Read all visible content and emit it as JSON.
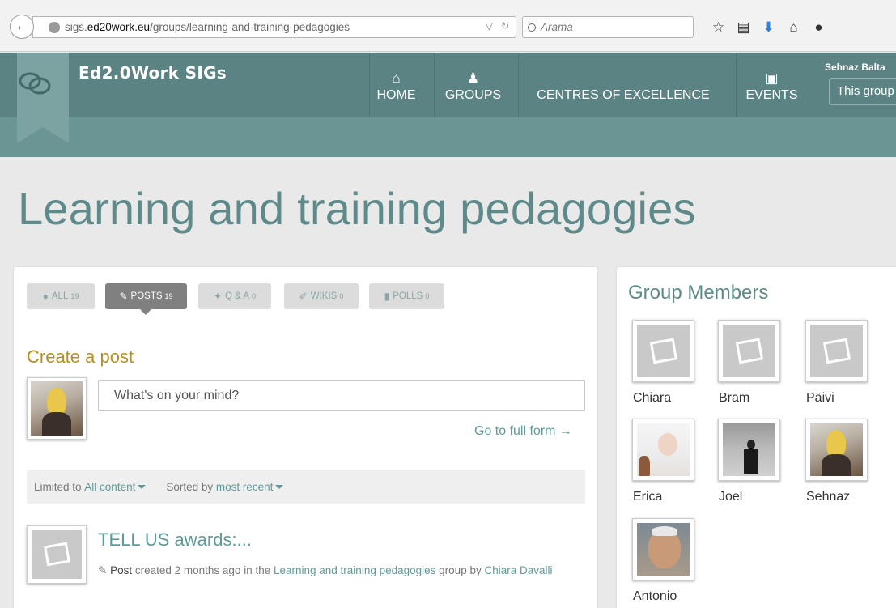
{
  "browser": {
    "url_prefix": "sigs.",
    "url_host": "ed20work.eu",
    "url_path": "/groups/learning-and-training-pedagogies",
    "search_placeholder": "Arama",
    "toolbar_icons": [
      "bookmark-star-icon",
      "reading-list-icon",
      "download-icon",
      "home-icon",
      "chat-icon"
    ]
  },
  "site": {
    "brand": "Ed2.0Work SIGs",
    "nav": [
      {
        "label": "HOME",
        "icon": "home-icon"
      },
      {
        "label": "GROUPS",
        "icon": "groups-icon"
      },
      {
        "label": "CENTRES OF EXCELLENCE",
        "icon": ""
      },
      {
        "label": "EVENTS",
        "icon": "calendar-icon"
      }
    ],
    "user_name": "Sehnaz Balta",
    "group_search": "This group"
  },
  "page": {
    "title": "Learning and training pedagogies"
  },
  "feed": {
    "tabs": [
      {
        "label": "ALL",
        "count": "19",
        "icon": "comments-icon"
      },
      {
        "label": "POSTS",
        "count": "19",
        "icon": "pencil-icon"
      },
      {
        "label": "Q & A",
        "count": "0",
        "icon": "qa-icon"
      },
      {
        "label": "WIKIS",
        "count": "0",
        "icon": "edit-icon"
      },
      {
        "label": "POLLS",
        "count": "0",
        "icon": "bar-chart-icon"
      }
    ],
    "active_tab": "POSTS",
    "create_heading": "Create a post",
    "post_placeholder": "What's on your mind?",
    "full_form_link": "Go to full form →",
    "filter": {
      "limited_label": "Limited to",
      "limited_value": "All content",
      "sorted_label": "Sorted by",
      "sorted_value": "most recent"
    },
    "posts": [
      {
        "title": "TELL US awards:...",
        "type": "Post",
        "meta_created": "created 2 months ago in the",
        "group_link": "Learning and training pedagogies",
        "meta_by": "group by",
        "author": "Chiara Davalli"
      }
    ]
  },
  "members": {
    "heading": "Group Members",
    "list": [
      {
        "name": "Chiara"
      },
      {
        "name": "Bram"
      },
      {
        "name": "Päivi"
      },
      {
        "name": "Erica"
      },
      {
        "name": "Joel"
      },
      {
        "name": "Sehnaz"
      },
      {
        "name": "Antonio"
      }
    ]
  }
}
